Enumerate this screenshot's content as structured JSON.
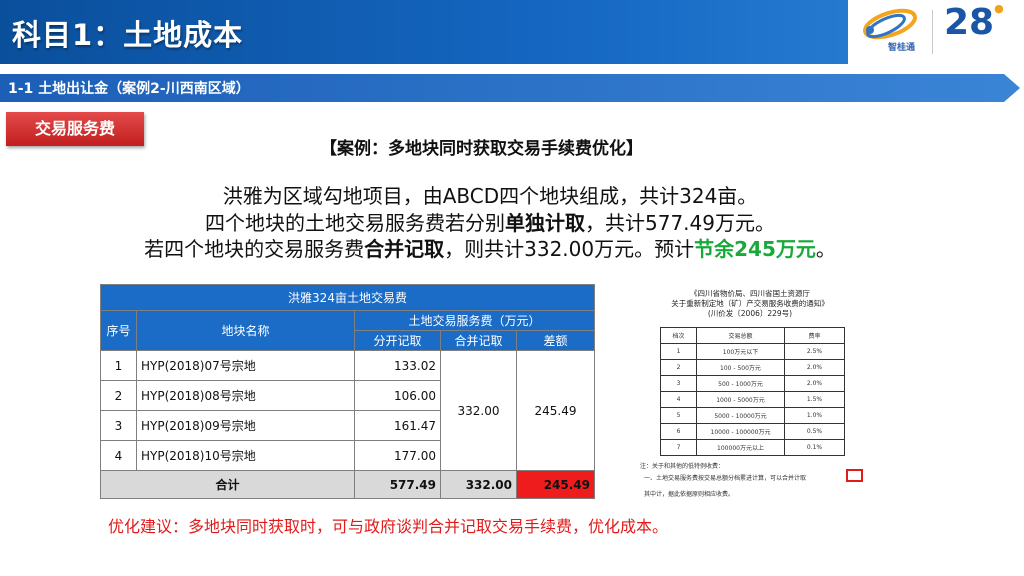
{
  "header": {
    "title": "科目1：土地成本"
  },
  "logo": {
    "brand_text": "智桂通",
    "years": "28"
  },
  "section": {
    "title": "1-1  土地出让金（案例2-川西南区域）"
  },
  "tag": {
    "label": "交易服务费"
  },
  "case": {
    "title": "【案例：多地块同时获取交易手续费优化】",
    "line1": "洪雅为区域勾地项目，由ABCD四个地块组成，共计324亩。",
    "line2_a": "四个地块的土地交易服务费若分别",
    "line2_b": "单独计取",
    "line2_c": "，共计577.49万元。",
    "line3_a": "若四个地块的交易服务费",
    "line3_b": "合并记取",
    "line3_c": "，则共计332.00万元。预计",
    "line3_d": "节余245万元",
    "line3_e": "。"
  },
  "table": {
    "title": "洪雅324亩土地交易费",
    "col_seq": "序号",
    "col_name": "地块名称",
    "col_group": "土地交易服务费（万元）",
    "col_sep": "分开记取",
    "col_merge": "合并记取",
    "col_diff": "差额",
    "rows": [
      {
        "seq": "1",
        "name": "HYP(2018)07号宗地",
        "sep": "133.02"
      },
      {
        "seq": "2",
        "name": "HYP(2018)08号宗地",
        "sep": "106.00"
      },
      {
        "seq": "3",
        "name": "HYP(2018)09号宗地",
        "sep": "161.47"
      },
      {
        "seq": "4",
        "name": "HYP(2018)10号宗地",
        "sep": "177.00"
      }
    ],
    "merge_value": "332.00",
    "diff_value": "245.49",
    "total": {
      "label": "合计",
      "sep": "577.49",
      "merge": "332.00",
      "diff": "245.49"
    }
  },
  "doc": {
    "head1": "《四川省物价局、四川省国土资源厅",
    "head2": "关于重新制定地（矿）产交易服务收费的通知》",
    "head3": "(川价发〔2006〕229号)",
    "col1": "档次",
    "col2": "交易总额",
    "col3": "费率",
    "rows": [
      {
        "a": "1",
        "b": "100万元以下",
        "c": "2.5%"
      },
      {
        "a": "2",
        "b": "100 - 500万元",
        "c": "2.0%"
      },
      {
        "a": "3",
        "b": "500 - 1000万元",
        "c": "2.0%"
      },
      {
        "a": "4",
        "b": "1000 - 5000万元",
        "c": "1.5%"
      },
      {
        "a": "5",
        "b": "5000 - 10000万元",
        "c": "1.0%"
      },
      {
        "a": "6",
        "b": "10000 - 100000万元",
        "c": "0.5%"
      },
      {
        "a": "7",
        "b": "100000万元以上",
        "c": "0.1%"
      }
    ],
    "note1": "注：关于和其他的低特例收费：",
    "note2": "一、土地交易服务费按交易总额分档累进计算，可以合并计取",
    "note3": "其中计，据此依据原则相应收费。"
  },
  "suggestion": "优化建议：多地块同时获取时，可与政府谈判合并记取交易手续费，优化成本。",
  "colors": {
    "header_blue": "#0a4f9c",
    "table_header_blue": "#1b6cc7",
    "highlight_red": "#ee1c1c",
    "saving_green": "#19a83a",
    "suggestion_red": "#e11b1b"
  }
}
